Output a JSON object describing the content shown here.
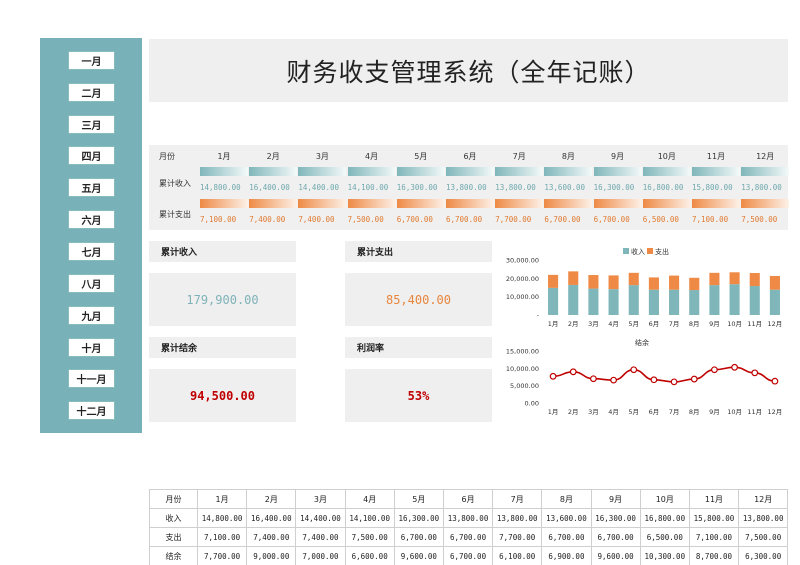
{
  "sidebar": {
    "months": [
      "一月",
      "二月",
      "三月",
      "四月",
      "五月",
      "六月",
      "七月",
      "八月",
      "九月",
      "十月",
      "十一月",
      "十二月"
    ]
  },
  "header": {
    "title": "财务收支管理系统（全年记账）"
  },
  "strip": {
    "month_label": "月份",
    "income_label": "累计收入",
    "expense_label": "累计支出",
    "months": [
      "1月",
      "2月",
      "3月",
      "4月",
      "5月",
      "6月",
      "7月",
      "8月",
      "9月",
      "10月",
      "11月",
      "12月"
    ],
    "income": [
      "14,800.00",
      "16,400.00",
      "14,400.00",
      "14,100.00",
      "16,300.00",
      "13,800.00",
      "13,800.00",
      "13,600.00",
      "16,300.00",
      "16,800.00",
      "15,800.00",
      "13,800.00"
    ],
    "expense": [
      "7,100.00",
      "7,400.00",
      "7,400.00",
      "7,500.00",
      "6,700.00",
      "6,700.00",
      "7,700.00",
      "6,700.00",
      "6,700.00",
      "6,500.00",
      "7,100.00",
      "7,500.00"
    ]
  },
  "kpis": {
    "income": {
      "label": "累计收入",
      "value": "179,900.00",
      "color": "#7fb3b8"
    },
    "expense": {
      "label": "累计支出",
      "value": "85,400.00",
      "color": "#e8863c"
    },
    "balance": {
      "label": "累计结余",
      "value": "94,500.00",
      "color": "#c00000"
    },
    "margin": {
      "label": "利润率",
      "value": "53%",
      "color": "#c00000"
    }
  },
  "colors": {
    "sidebar": "#78B1B8",
    "income": "#7fb6ba",
    "expense": "#ee8a45",
    "balance_line": "#c00000"
  },
  "chart_data": [
    {
      "type": "bar",
      "title": "",
      "stacked": true,
      "categories": [
        "1月",
        "2月",
        "3月",
        "4月",
        "5月",
        "6月",
        "7月",
        "8月",
        "9月",
        "10月",
        "11月",
        "12月"
      ],
      "series": [
        {
          "name": "收入",
          "values": [
            14800,
            16400,
            14400,
            14100,
            16300,
            13800,
            13800,
            13600,
            16300,
            16800,
            15800,
            13800
          ]
        },
        {
          "name": "支出",
          "values": [
            7100,
            7400,
            7400,
            7500,
            6700,
            6700,
            7700,
            6700,
            6700,
            6500,
            7100,
            7500
          ]
        }
      ],
      "ylim": [
        0,
        30000
      ],
      "yticks": [
        "-",
        "10,000.00",
        "20,000.00",
        "30,000.00"
      ],
      "legend": "top-center"
    },
    {
      "type": "line",
      "title": "结余",
      "categories": [
        "1月",
        "2月",
        "3月",
        "4月",
        "5月",
        "6月",
        "7月",
        "8月",
        "9月",
        "10月",
        "11月",
        "12月"
      ],
      "values": [
        7700,
        9000,
        7000,
        6600,
        9600,
        6700,
        6100,
        6900,
        9600,
        10300,
        8700,
        6300
      ],
      "ylim": [
        0,
        15000
      ],
      "yticks": [
        "0.00",
        "5,000.00",
        "10,000.00",
        "15,000.00"
      ]
    }
  ],
  "table": {
    "headers": [
      "月份",
      "1月",
      "2月",
      "3月",
      "4月",
      "5月",
      "6月",
      "7月",
      "8月",
      "9月",
      "10月",
      "11月",
      "12月"
    ],
    "rows": [
      {
        "label": "收入",
        "values": [
          "14,800.00",
          "16,400.00",
          "14,400.00",
          "14,100.00",
          "16,300.00",
          "13,800.00",
          "13,800.00",
          "13,600.00",
          "16,300.00",
          "16,800.00",
          "15,800.00",
          "13,800.00"
        ]
      },
      {
        "label": "支出",
        "values": [
          "7,100.00",
          "7,400.00",
          "7,400.00",
          "7,500.00",
          "6,700.00",
          "6,700.00",
          "7,700.00",
          "6,700.00",
          "6,700.00",
          "6,500.00",
          "7,100.00",
          "7,500.00"
        ]
      },
      {
        "label": "结余",
        "values": [
          "7,700.00",
          "9,000.00",
          "7,000.00",
          "6,600.00",
          "9,600.00",
          "6,700.00",
          "6,100.00",
          "6,900.00",
          "9,600.00",
          "10,300.00",
          "8,700.00",
          "6,300.00"
        ]
      }
    ]
  }
}
